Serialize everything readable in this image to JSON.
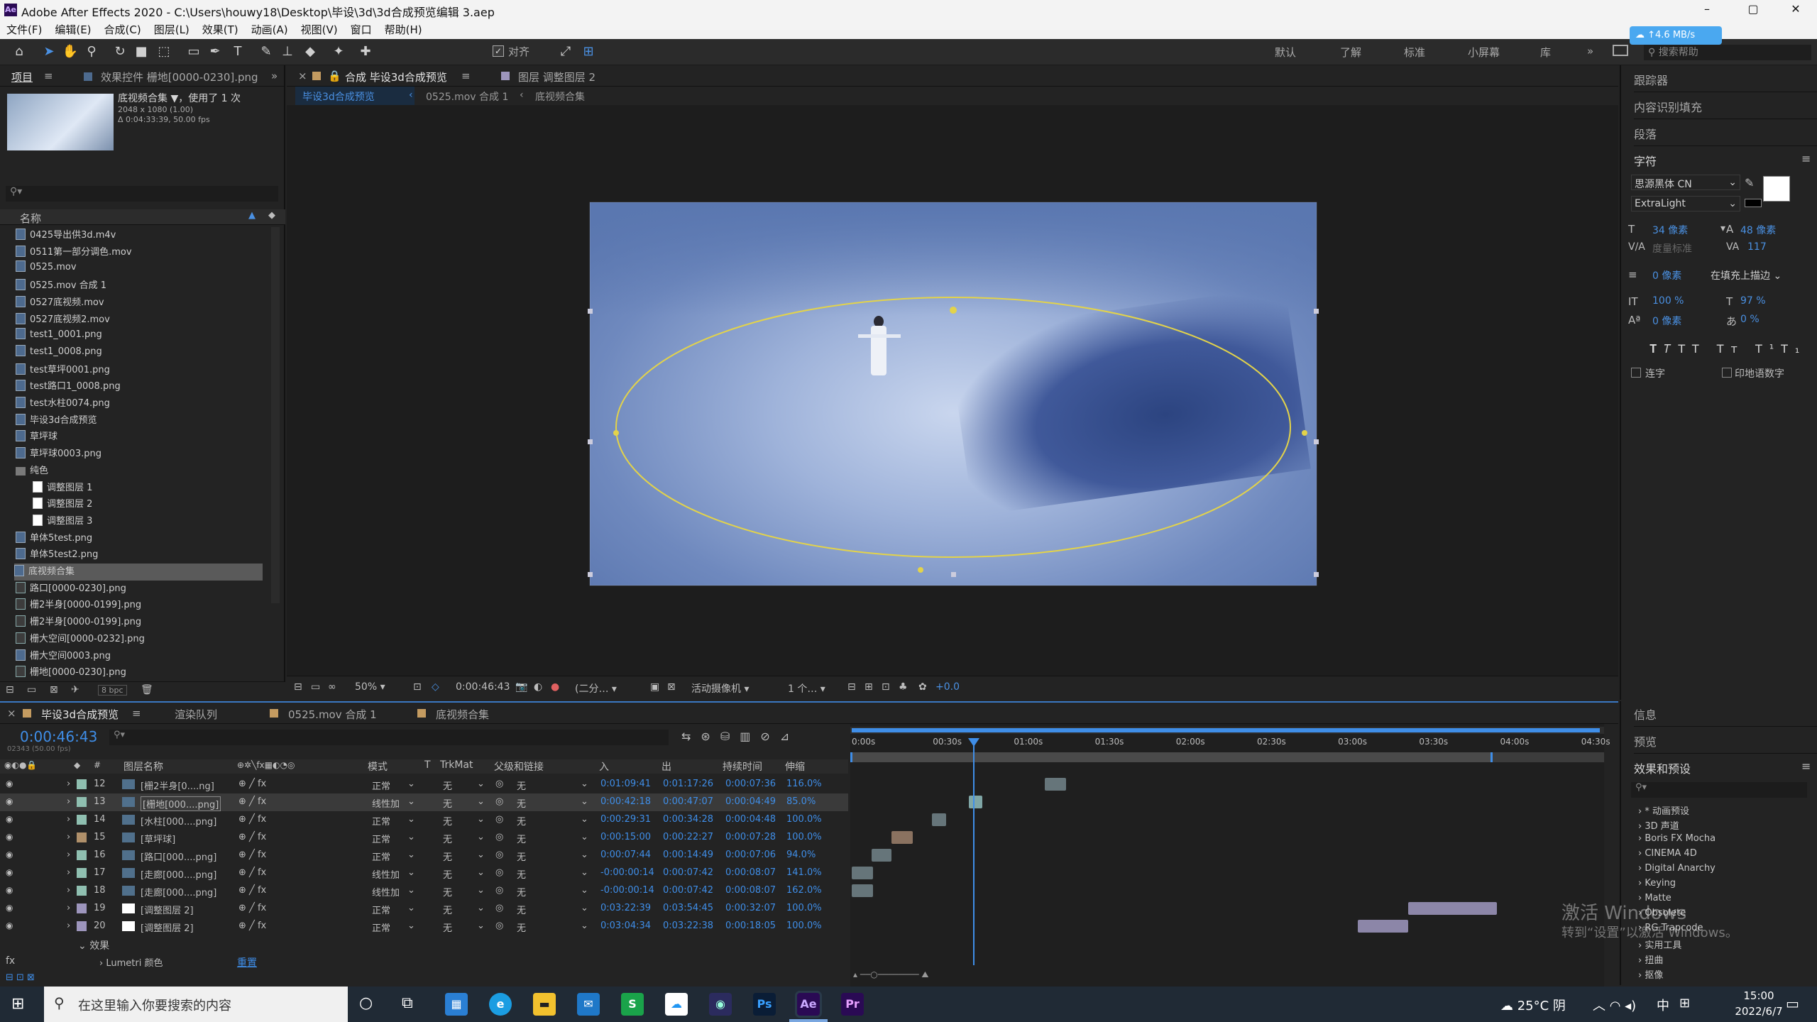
{
  "window": {
    "title": "Adobe After Effects 2020 - C:\\Users\\houwy18\\Desktop\\毕设\\3d\\3d合成预览编辑 3.aep",
    "min": "–",
    "max": "▢",
    "close": "✕"
  },
  "menu": [
    "文件(F)",
    "编辑(E)",
    "合成(C)",
    "图层(L)",
    "效果(T)",
    "动画(A)",
    "视图(V)",
    "窗口",
    "帮助(H)"
  ],
  "toolbar": {
    "align_label": "对齐",
    "workspaces": [
      "默认",
      "了解",
      "标准",
      "小屏幕",
      "库"
    ],
    "search_help": "搜索帮助",
    "net_speed": "↑4.6 MB/s"
  },
  "project": {
    "tab_project": "项目",
    "tab_effects": "效果控件 栅地[0000-0230].png",
    "thumb_name": "底视频合集 ▼，使用了 1 次",
    "thumb_size": "2048 x 1080 (1.00)",
    "thumb_dur": "Δ 0:04:33:39, 50.00 fps",
    "search_placeholder": "",
    "col_name": "名称",
    "files": [
      {
        "name": "0425导出供3d.m4v",
        "kind": "mov",
        "indent": 0
      },
      {
        "name": "0511第一部分调色.mov",
        "kind": "mov",
        "indent": 0
      },
      {
        "name": "0525.mov",
        "kind": "mov",
        "indent": 0
      },
      {
        "name": "0525.mov 合成 1",
        "kind": "comp",
        "indent": 0
      },
      {
        "name": "0527底视频.mov",
        "kind": "mov",
        "indent": 0
      },
      {
        "name": "0527底视频2.mov",
        "kind": "mov",
        "indent": 0
      },
      {
        "name": "test1_0001.png",
        "kind": "mov",
        "indent": 0
      },
      {
        "name": "test1_0008.png",
        "kind": "mov",
        "indent": 0
      },
      {
        "name": "test草坪0001.png",
        "kind": "mov",
        "indent": 0
      },
      {
        "name": "test路口1_0008.png",
        "kind": "mov",
        "indent": 0
      },
      {
        "name": "test水柱0074.png",
        "kind": "mov",
        "indent": 0
      },
      {
        "name": "毕设3d合成预览",
        "kind": "comp",
        "indent": 0
      },
      {
        "name": "草坪球",
        "kind": "comp",
        "indent": 0
      },
      {
        "name": "草坪球0003.png",
        "kind": "mov",
        "indent": 0
      },
      {
        "name": "纯色",
        "kind": "folder",
        "indent": 0
      },
      {
        "name": "调整图层 1",
        "kind": "solid",
        "indent": 1
      },
      {
        "name": "调整图层 2",
        "kind": "solid",
        "indent": 1
      },
      {
        "name": "调整图层 3",
        "kind": "solid",
        "indent": 1
      },
      {
        "name": "单体5test.png",
        "kind": "mov",
        "indent": 0
      },
      {
        "name": "单体5test2.png",
        "kind": "mov",
        "indent": 0
      },
      {
        "name": "底视频合集",
        "kind": "comp",
        "indent": 0,
        "selected": true
      },
      {
        "name": "路口[0000-0230].png",
        "kind": "img",
        "indent": 0
      },
      {
        "name": "栅2半身[0000-0199].png",
        "kind": "img",
        "indent": 0
      },
      {
        "name": "栅2半身[0000-0199].png",
        "kind": "img",
        "indent": 0
      },
      {
        "name": "栅大空间[0000-0232].png",
        "kind": "img",
        "indent": 0
      },
      {
        "name": "栅大空间0003.png",
        "kind": "mov",
        "indent": 0
      },
      {
        "name": "栅地[0000-0230].png",
        "kind": "img",
        "indent": 0
      }
    ],
    "bpc": "8 bpc"
  },
  "comp": {
    "tab_comp": "合成 毕设3d合成预览",
    "tab_layer": "图层 调整图层 2",
    "crumbs": [
      "毕设3d合成预览",
      "0525.mov 合成 1",
      "底视频合集"
    ],
    "zoom": "50%",
    "timecode": "0:00:46:43",
    "resolution": "(二分…",
    "camera": "活动摄像机",
    "views": "1 个…",
    "exposure": "+0.0"
  },
  "timeline": {
    "tabs": [
      "毕设3d合成预览",
      "渲染队列",
      "0525.mov 合成 1",
      "底视频合集"
    ],
    "timecode": "0:00:46:43",
    "fps": "02343 (50.00 fps)",
    "headers": {
      "name": "图层名称",
      "mode": "模式",
      "t": "T",
      "trkmat": "TrkMat",
      "parent": "父级和链接",
      "in": "入",
      "out": "出",
      "dur": "持续时间",
      "stretch": "伸缩"
    },
    "ruler": [
      "0:00s",
      "00:30s",
      "01:00s",
      "01:30s",
      "02:00s",
      "02:30s",
      "03:00s",
      "03:30s",
      "04:00s",
      "04:30s"
    ],
    "rows": [
      {
        "num": "12",
        "color": "#8fbfb0",
        "name": "[栅2半身[0....ng]",
        "mode": "正常",
        "trk": "无",
        "parent": "无",
        "in": "0:01:09:41",
        "out": "0:01:17:26",
        "dur": "0:00:07:36",
        "stretch": "116.0%",
        "bar_start": 0.258,
        "bar_end": 0.286,
        "bar_color": "#66757a"
      },
      {
        "num": "13",
        "color": "#8fbfb0",
        "name": "[栅地[000....png]",
        "mode": "线性加",
        "trk": "无",
        "parent": "无",
        "in": "0:00:42:18",
        "out": "0:00:47:07",
        "dur": "0:00:04:49",
        "stretch": "85.0%",
        "bar_start": 0.157,
        "bar_end": 0.175,
        "bar_color": "#7fa6a6",
        "selected": true
      },
      {
        "num": "14",
        "color": "#8fbfb0",
        "name": "[水柱[000....png]",
        "mode": "正常",
        "trk": "无",
        "parent": "无",
        "in": "0:00:29:31",
        "out": "0:00:34:28",
        "dur": "0:00:04:48",
        "stretch": "100.0%",
        "bar_start": 0.108,
        "bar_end": 0.127,
        "bar_color": "#66757a"
      },
      {
        "num": "15",
        "color": "#b0906a",
        "name": "[草坪球]",
        "mode": "正常",
        "trk": "无",
        "parent": "无",
        "in": "0:00:15:00",
        "out": "0:00:22:27",
        "dur": "0:00:07:28",
        "stretch": "100.0%",
        "bar_start": 0.055,
        "bar_end": 0.083,
        "bar_color": "#8a7260"
      },
      {
        "num": "16",
        "color": "#8fbfb0",
        "name": "[路口[000....png]",
        "mode": "正常",
        "trk": "无",
        "parent": "无",
        "in": "0:00:07:44",
        "out": "0:00:14:49",
        "dur": "0:00:07:06",
        "stretch": "94.0%",
        "bar_start": 0.028,
        "bar_end": 0.055,
        "bar_color": "#66757a"
      },
      {
        "num": "17",
        "color": "#8fbfb0",
        "name": "[走廊[000....png]",
        "mode": "线性加",
        "trk": "无",
        "parent": "无",
        "in": "-0:00:00:14",
        "out": "0:00:07:42",
        "dur": "0:00:08:07",
        "stretch": "141.0%",
        "bar_start": 0.002,
        "bar_end": 0.03,
        "bar_color": "#66757a"
      },
      {
        "num": "18",
        "color": "#8fbfb0",
        "name": "[走廊[000....png]",
        "mode": "线性加",
        "trk": "无",
        "parent": "无",
        "in": "-0:00:00:14",
        "out": "0:00:07:42",
        "dur": "0:00:08:07",
        "stretch": "162.0%",
        "bar_start": 0.002,
        "bar_end": 0.03,
        "bar_color": "#66757a"
      },
      {
        "num": "19",
        "color": "#9d95bc",
        "name": "[调整图层 2]",
        "mode": "正常",
        "trk": "无",
        "parent": "无",
        "in": "0:03:22:39",
        "out": "0:03:54:45",
        "dur": "0:00:32:07",
        "stretch": "100.0%",
        "bar_start": 0.74,
        "bar_end": 0.858,
        "bar_color": "#8c86a8"
      },
      {
        "num": "20",
        "color": "#9d95bc",
        "name": "[调整图层 2]",
        "mode": "正常",
        "trk": "无",
        "parent": "无",
        "in": "0:03:04:34",
        "out": "0:03:22:38",
        "dur": "0:00:18:05",
        "stretch": "100.0%",
        "bar_start": 0.673,
        "bar_end": 0.74,
        "bar_color": "#8c86a8"
      }
    ],
    "effects_label": "效果",
    "lumetri_label": "Lumetri 颜色",
    "reset_label": "重置",
    "playhead": 0.163
  },
  "right_panels": {
    "tracker": "跟踪器",
    "content_fill": "内容识别填充",
    "paragraph": "段落",
    "character": "字符",
    "info": "信息",
    "preview": "预览",
    "effects_presets": "效果和预设"
  },
  "character": {
    "font": "思源黑体 CN",
    "style": "ExtraLight",
    "size": "34 像素",
    "leading": "48 像素",
    "kern": "度量标准",
    "tracking": "117",
    "stroke": "0 像素",
    "stroke_mode": "在填充上描边",
    "v_scale": "100 %",
    "h_scale": "97 %",
    "baseline": "0 像素",
    "tsume": "0 %",
    "ligatures": "连字",
    "hindi": "印地语数字"
  },
  "effects_list": [
    "* 动画预设",
    "3D 声道",
    "Boris FX Mocha",
    "CINEMA 4D",
    "Digital Anarchy",
    "Keying",
    "Matte",
    "Obsolete",
    "RG Trapcode",
    "实用工具",
    "扭曲",
    "抠像"
  ],
  "watermark": {
    "line1": "激活 Windows",
    "line2": "转到“设置”以激活 Windows。"
  },
  "taskbar": {
    "search": "在这里输入你要搜索的内容",
    "weather": "25°C 阴",
    "ime": "中",
    "time": "15:00",
    "date": "2022/6/7"
  }
}
